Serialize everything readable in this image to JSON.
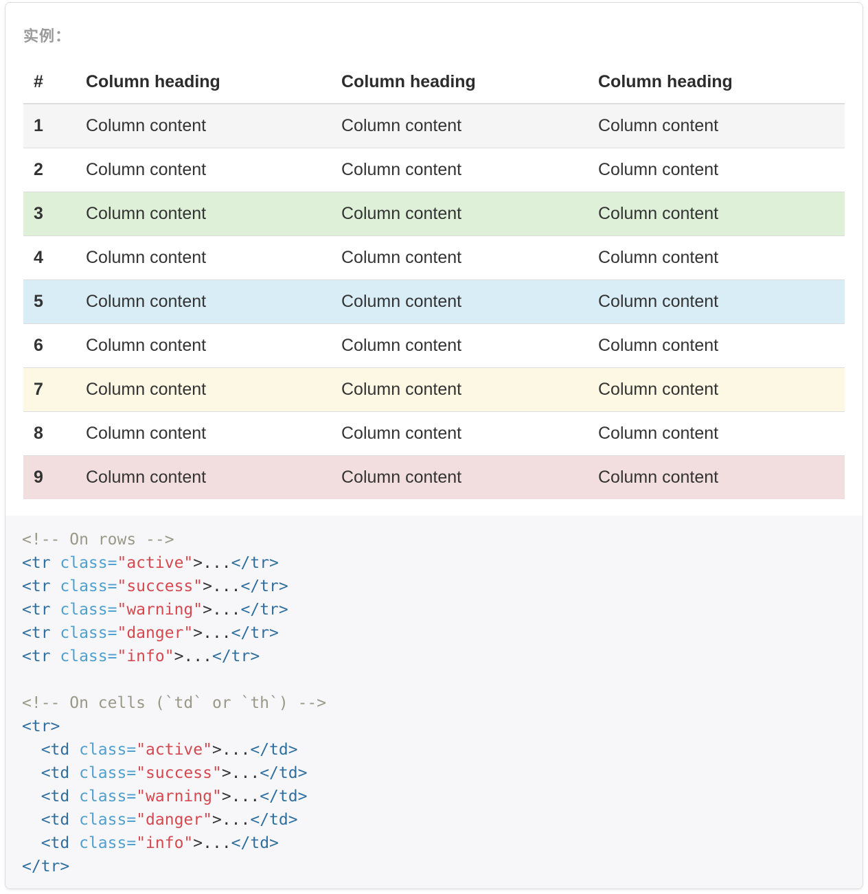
{
  "example_label": "实例：",
  "table": {
    "headers": [
      "#",
      "Column heading",
      "Column heading",
      "Column heading"
    ],
    "rows": [
      {
        "num": "1",
        "cells": [
          "Column content",
          "Column content",
          "Column content"
        ],
        "state": "active"
      },
      {
        "num": "2",
        "cells": [
          "Column content",
          "Column content",
          "Column content"
        ],
        "state": "default"
      },
      {
        "num": "3",
        "cells": [
          "Column content",
          "Column content",
          "Column content"
        ],
        "state": "success"
      },
      {
        "num": "4",
        "cells": [
          "Column content",
          "Column content",
          "Column content"
        ],
        "state": "default"
      },
      {
        "num": "5",
        "cells": [
          "Column content",
          "Column content",
          "Column content"
        ],
        "state": "info"
      },
      {
        "num": "6",
        "cells": [
          "Column content",
          "Column content",
          "Column content"
        ],
        "state": "default"
      },
      {
        "num": "7",
        "cells": [
          "Column content",
          "Column content",
          "Column content"
        ],
        "state": "warning"
      },
      {
        "num": "8",
        "cells": [
          "Column content",
          "Column content",
          "Column content"
        ],
        "state": "default"
      },
      {
        "num": "9",
        "cells": [
          "Column content",
          "Column content",
          "Column content"
        ],
        "state": "danger"
      }
    ]
  },
  "code": {
    "comment_rows": "<!-- On rows -->",
    "rows_lines": [
      {
        "tag_open": "<tr",
        "attr": " class=",
        "value": "\"active\"",
        "rest": ">...",
        "tag_close": "</tr>"
      },
      {
        "tag_open": "<tr",
        "attr": " class=",
        "value": "\"success\"",
        "rest": ">...",
        "tag_close": "</tr>"
      },
      {
        "tag_open": "<tr",
        "attr": " class=",
        "value": "\"warning\"",
        "rest": ">...",
        "tag_close": "</tr>"
      },
      {
        "tag_open": "<tr",
        "attr": " class=",
        "value": "\"danger\"",
        "rest": ">...",
        "tag_close": "</tr>"
      },
      {
        "tag_open": "<tr",
        "attr": " class=",
        "value": "\"info\"",
        "rest": ">...",
        "tag_close": "</tr>"
      }
    ],
    "comment_cells": "<!-- On cells (`td` or `th`) -->",
    "tr_open": "<tr>",
    "cells_lines": [
      {
        "indent": "  ",
        "tag_open": "<td",
        "attr": " class=",
        "value": "\"active\"",
        "rest": ">...",
        "tag_close": "</td>"
      },
      {
        "indent": "  ",
        "tag_open": "<td",
        "attr": " class=",
        "value": "\"success\"",
        "rest": ">...",
        "tag_close": "</td>"
      },
      {
        "indent": "  ",
        "tag_open": "<td",
        "attr": " class=",
        "value": "\"warning\"",
        "rest": ">...",
        "tag_close": "</td>"
      },
      {
        "indent": "  ",
        "tag_open": "<td",
        "attr": " class=",
        "value": "\"danger\"",
        "rest": ">...",
        "tag_close": "</td>"
      },
      {
        "indent": "  ",
        "tag_open": "<td",
        "attr": " class=",
        "value": "\"info\"",
        "rest": ">...",
        "tag_close": "</td>"
      }
    ],
    "tr_close": "</tr>"
  },
  "colors": {
    "active": "#f5f5f5",
    "success": "#dff0d8",
    "info": "#d9edf7",
    "warning": "#fcf8e3",
    "danger": "#f2dede",
    "code_bg": "#f7f7f9",
    "code_tag": "#2f6f9f",
    "code_attr": "#4f9fcf",
    "code_string": "#d44950",
    "code_comment": "#999988"
  }
}
